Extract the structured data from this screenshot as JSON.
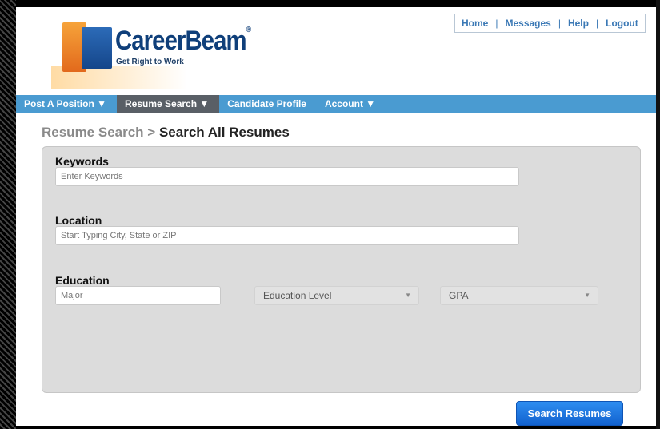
{
  "topnav": {
    "links": [
      "Home",
      "Messages",
      "Help",
      "Logout"
    ]
  },
  "logo": {
    "brand": "CareerBeam",
    "registered": "®",
    "tagline": "Get Right to Work"
  },
  "mainnav": {
    "items": [
      {
        "label": "Post A Position ▼",
        "active": false
      },
      {
        "label": "Resume Search ▼",
        "active": true
      },
      {
        "label": "Candidate Profile",
        "active": false
      },
      {
        "label": "Account ▼",
        "active": false
      }
    ]
  },
  "breadcrumb": {
    "parent": "Resume Search >",
    "current": "Search All Resumes"
  },
  "form": {
    "keywords": {
      "label": "Keywords",
      "placeholder": "Enter Keywords"
    },
    "location": {
      "label": "Location",
      "placeholder": "Start Typing City, State or ZIP"
    },
    "education": {
      "label": "Education",
      "major_placeholder": "Major",
      "level": "Education Level",
      "gpa": "GPA"
    },
    "submit": "Search Resumes"
  },
  "colors": {
    "nav_blue": "#4a9bd1",
    "nav_active": "#595f66",
    "link_blue": "#3a78b5",
    "button_blue": "#1a74e0"
  }
}
